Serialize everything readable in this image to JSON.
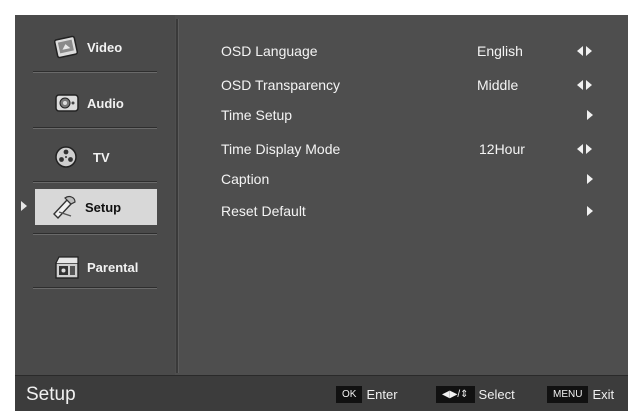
{
  "sidebar": {
    "items": [
      {
        "label": "Video",
        "icon": "video-icon"
      },
      {
        "label": "Audio",
        "icon": "audio-icon"
      },
      {
        "label": "TV",
        "icon": "tv-icon"
      },
      {
        "label": "Setup",
        "icon": "setup-icon",
        "selected": true
      },
      {
        "label": "Parental",
        "icon": "parental-icon"
      }
    ]
  },
  "menu": {
    "rows": [
      {
        "label": "OSD Language",
        "value": "English",
        "control": "left-right-arrows"
      },
      {
        "label": "OSD Transparency",
        "value": "Middle",
        "control": "left-right-arrows"
      },
      {
        "label": "Time Setup",
        "value": "",
        "control": "right-arrow"
      },
      {
        "label": "Time Display Mode",
        "value": "12Hour",
        "control": "left-right-arrows"
      },
      {
        "label": "Caption",
        "value": "",
        "control": "right-arrow"
      },
      {
        "label": "Reset Default",
        "value": "",
        "control": "right-arrow"
      }
    ]
  },
  "footer": {
    "title": "Setup",
    "hints": [
      {
        "key": "OK",
        "action": "Enter"
      },
      {
        "key": "◀▶/⇕",
        "action": "Select"
      },
      {
        "key": "MENU",
        "action": "Exit"
      }
    ]
  }
}
